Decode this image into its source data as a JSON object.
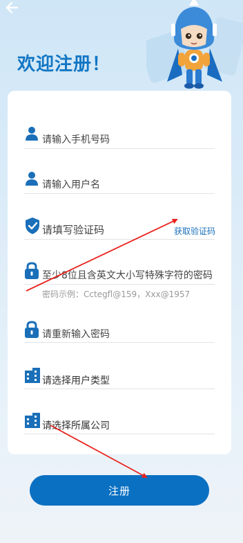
{
  "header": {
    "title": "欢迎注册！"
  },
  "form": {
    "phone_placeholder": "请输入手机号码",
    "username_placeholder": "请输入用户名",
    "code_placeholder": "请填写验证码",
    "get_code_label": "获取验证码",
    "password_placeholder": "至少8位且含英文大小写特殊字符的密码",
    "password_hint": "密码示例：Cctegfl@159，Xxx@1957",
    "confirm_placeholder": "请重新输入密码",
    "user_type_placeholder": "请选择用户类型",
    "company_placeholder": "请选择所属公司"
  },
  "actions": {
    "register_label": "注册"
  },
  "icons": {
    "back": "back-arrow-icon",
    "user": "user-icon",
    "shield": "shield-check-icon",
    "lock": "lock-icon",
    "building": "building-icon"
  },
  "colors": {
    "primary": "#0a70c2",
    "annotation": "#e8231e"
  }
}
